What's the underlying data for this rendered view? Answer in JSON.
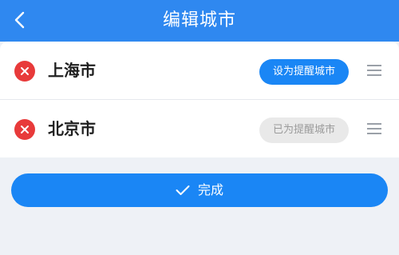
{
  "header": {
    "title": "编辑城市",
    "back_icon": "chevron-left-icon"
  },
  "cities": [
    {
      "name": "上海市",
      "remind_label": "设为提醒城市",
      "remind_state": "active"
    },
    {
      "name": "北京市",
      "remind_label": "已为提醒城市",
      "remind_state": "disabled"
    }
  ],
  "footer": {
    "done_label": "完成",
    "done_icon": "check-icon"
  },
  "colors": {
    "primary": "#1a86f5",
    "header": "#2f88f0",
    "delete": "#e83a3a",
    "background": "#eef1f6"
  }
}
